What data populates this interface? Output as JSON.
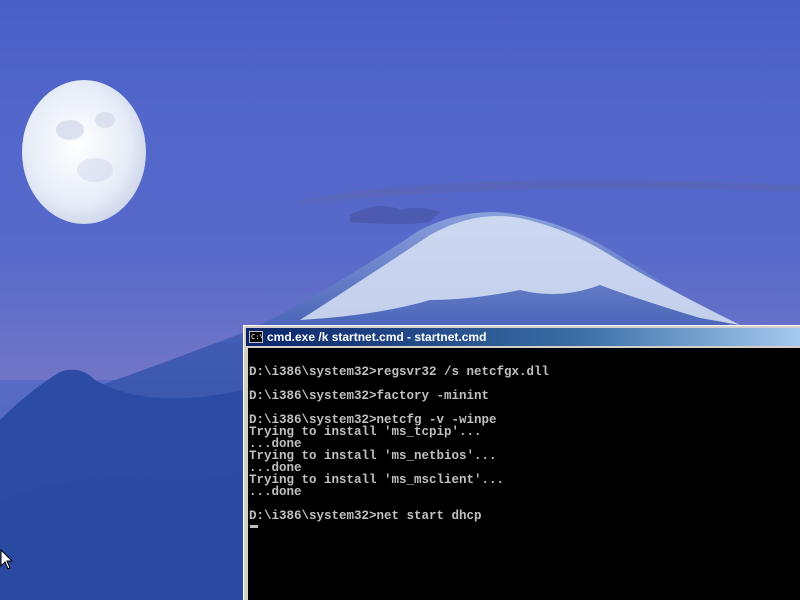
{
  "desktop": {
    "wallpaper": "moon-over-mountain",
    "colors": {
      "sky": "#5468cc",
      "mountain": "#2f4fa8",
      "snow": "#e6ecf7"
    }
  },
  "cmd_window": {
    "title": "cmd.exe /k startnet.cmd - startnet.cmd",
    "icon": "cmd-icon",
    "icon_text": "C:\\",
    "lines": [
      "",
      "D:\\i386\\system32>regsvr32 /s netcfgx.dll",
      "",
      "D:\\i386\\system32>factory -minint",
      "",
      "D:\\i386\\system32>netcfg -v -winpe",
      "Trying to install 'ms_tcpip'...",
      "...done",
      "Trying to install 'ms_netbios'...",
      "...done",
      "Trying to install 'ms_msclient'...",
      "...done",
      "",
      "D:\\i386\\system32>net start dhcp"
    ]
  }
}
